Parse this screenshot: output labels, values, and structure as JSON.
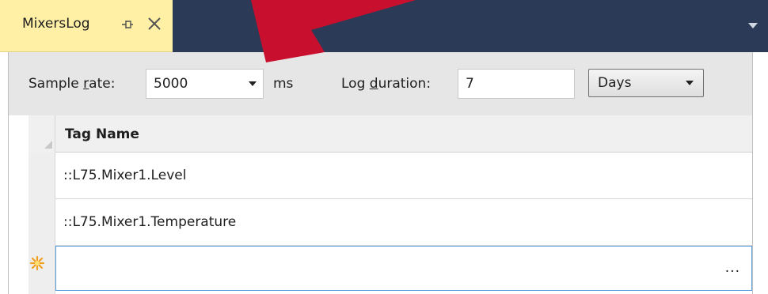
{
  "window": {
    "tab_title": "MixersLog",
    "pin_icon": "pin-icon",
    "close_icon": "close-icon",
    "dropdown_icon": "chevron-down-icon"
  },
  "toolbar": {
    "sample_rate_label_pre": "Sample ",
    "sample_rate_label_accel": "r",
    "sample_rate_label_post": "ate:",
    "sample_rate_value": "5000",
    "sample_rate_unit": "ms",
    "log_duration_label_pre": "Log ",
    "log_duration_label_accel": "d",
    "log_duration_label_post": "uration:",
    "log_duration_value": "7",
    "duration_unit_selected": "Days"
  },
  "grid": {
    "header": "Tag Name",
    "rows": [
      {
        "tag_name": "::L75.Mixer1.Level"
      },
      {
        "tag_name": "::L75.Mixer1.Temperature"
      }
    ],
    "new_row_button": "..."
  },
  "colors": {
    "titlebar": "#2b3a57",
    "active_tab": "#fff0a6",
    "arrow_red": "#c8102e",
    "new_row_border": "#5aa0e0"
  }
}
